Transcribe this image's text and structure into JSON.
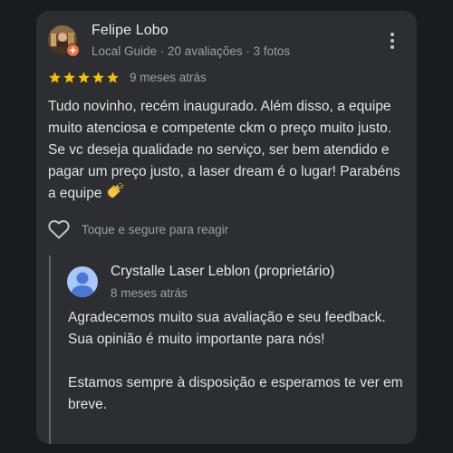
{
  "review": {
    "reviewer_name": "Felipe Lobo",
    "reviewer_meta": "Local Guide · 20 avaliações · 3 fotos",
    "rating": 5,
    "date": "9 meses atrás",
    "text": "Tudo novinho, recém inaugurado. Além disso, a equipe muito atenciosa e competente ckm o preço muito justo. Se vc deseja qualidade no serviço, ser bem atendido e pagar um preço justo, a laser dream é o lugar! Parabéns a equipe",
    "react_label": "Toque e segure para reagir"
  },
  "owner_reply": {
    "name": "Crystalle Laser Leblon (proprietário)",
    "date": "8 meses atrás",
    "paragraph_1": "Agradecemos muito sua avaliação e seu feedback. Sua opinião é muito importante para nós!",
    "paragraph_2": "Estamos sempre à disposição e esperamos te ver em breve."
  },
  "icons": {
    "more": "more-vert-icon",
    "star": "star-icon",
    "heart": "heart-outline-icon",
    "clap": "clapping-hands-emoji",
    "owner_avatar": "person-icon",
    "guide_badge": "local-guide-badge-icon"
  },
  "colors": {
    "page_background": "#1a1b1e",
    "card_background": "#2d2e31",
    "star": "#fbbc04",
    "owner_avatar_bg": "#a8c7fa",
    "owner_avatar_fg": "#4a78d4",
    "guide_badge": "#e8713a"
  }
}
